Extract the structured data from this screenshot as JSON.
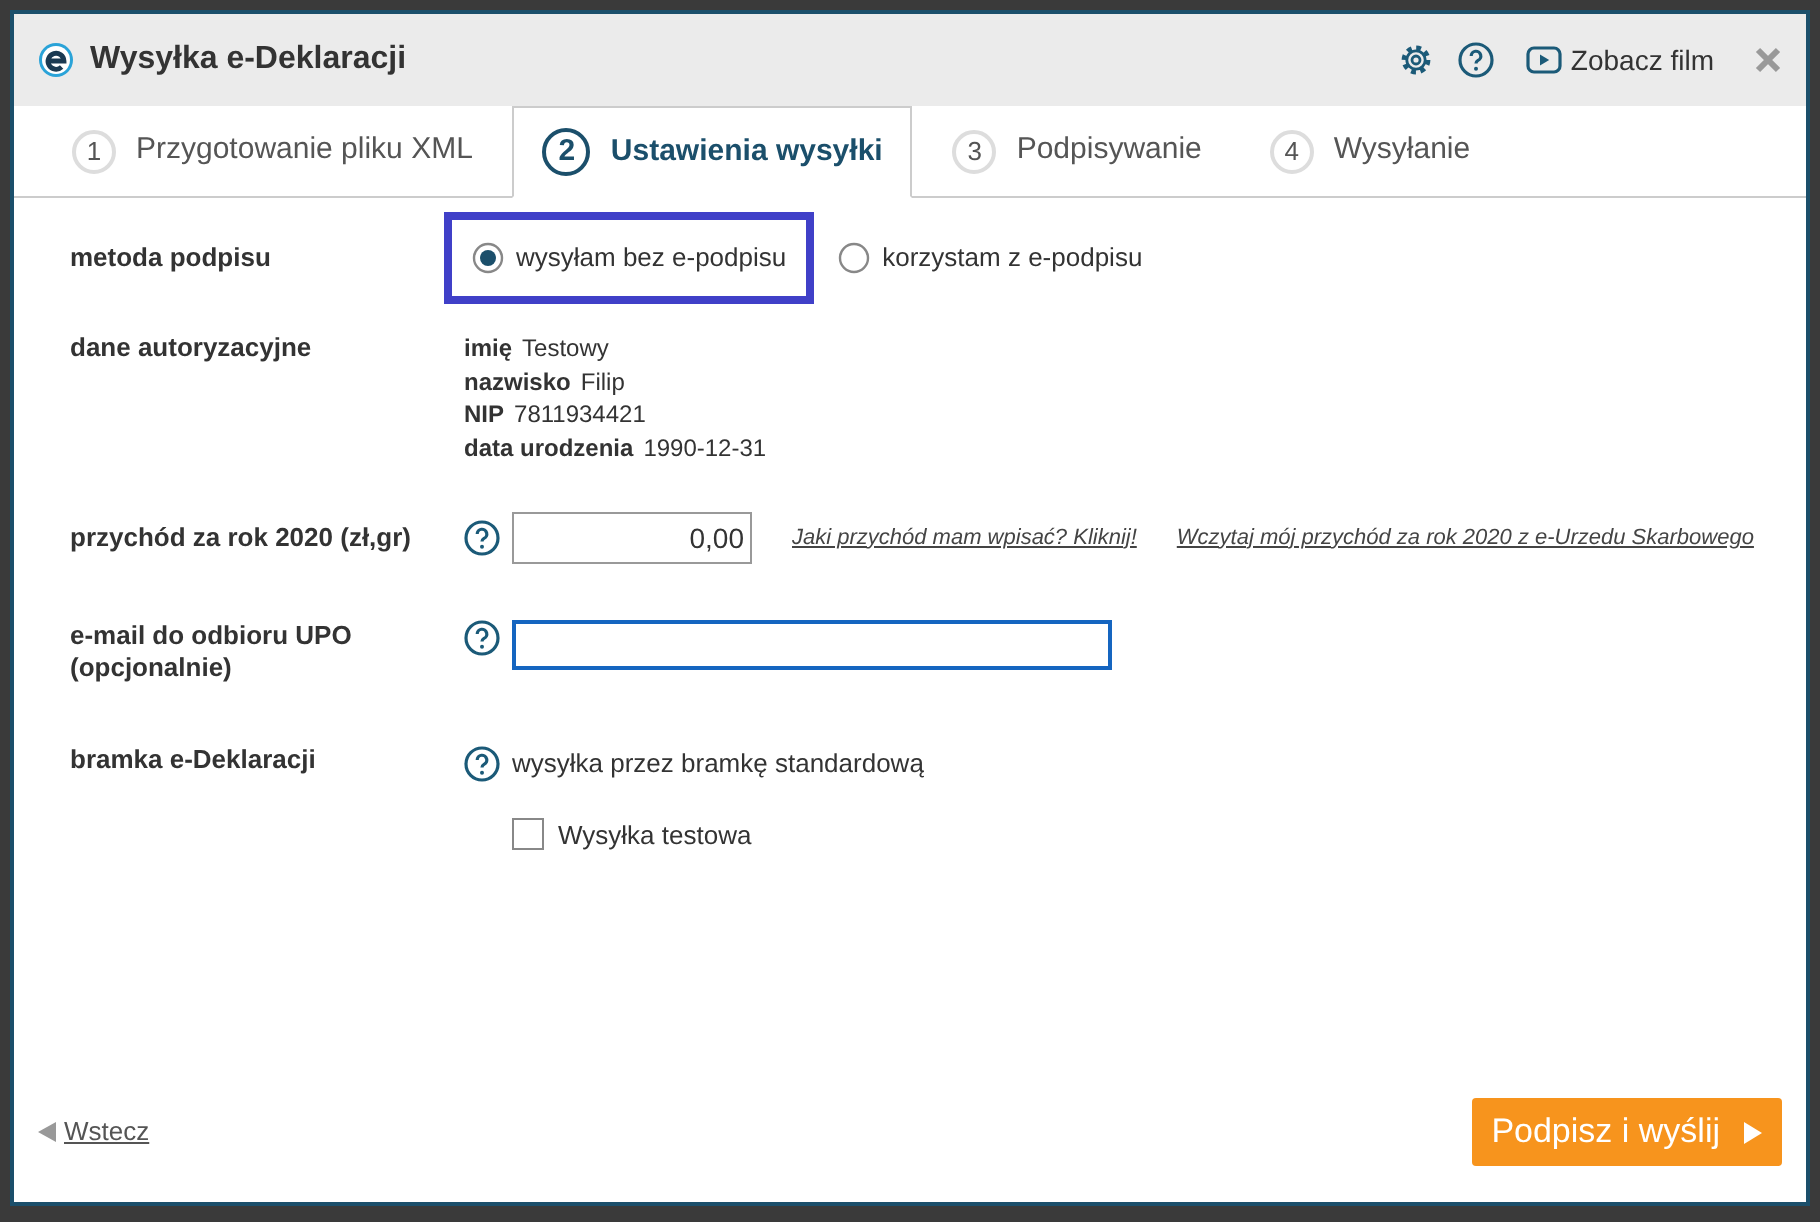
{
  "window": {
    "title": "Wysyłka e-Deklaracji",
    "video_link": "Zobacz film"
  },
  "tabs": [
    {
      "number": "1",
      "label": "Przygotowanie pliku XML",
      "selected": false
    },
    {
      "number": "2",
      "label": "Ustawienia wysyłki",
      "selected": true
    },
    {
      "number": "3",
      "label": "Podpisywanie",
      "selected": false
    },
    {
      "number": "4",
      "label": "Wysyłanie",
      "selected": false
    }
  ],
  "signature_method": {
    "label": "metoda podpisu",
    "options": [
      {
        "label": "wysyłam bez e-podpisu",
        "selected": true,
        "highlighted": true
      },
      {
        "label": "korzystam z e-podpisu",
        "selected": false,
        "highlighted": false
      }
    ]
  },
  "auth_data": {
    "label": "dane autoryzacyjne",
    "fields": [
      {
        "name": "imię",
        "value": "Testowy"
      },
      {
        "name": "nazwisko",
        "value": "Filip"
      },
      {
        "name": "NIP",
        "value": "7811934421"
      },
      {
        "name": "data urodzenia",
        "value": "1990-12-31"
      }
    ]
  },
  "income": {
    "label": "przychód za rok 2020 (zł,gr)",
    "value": "0,00",
    "links": [
      "Jaki przychód mam wpisać? Kliknij!",
      "Wczytaj mój przychód za rok 2020 z e-Urzedu Skarbowego"
    ]
  },
  "email": {
    "label": "e-mail do odbioru UPO (opcjonalnie)",
    "focused": true
  },
  "gateway": {
    "label": "bramka e-Deklaracji",
    "value": "wysyłka przez bramkę standardową",
    "test_send": {
      "label": "Wysyłka testowa",
      "checked": false
    }
  },
  "footer": {
    "back": "Wstecz",
    "submit": "Podpisz i wyślij"
  }
}
